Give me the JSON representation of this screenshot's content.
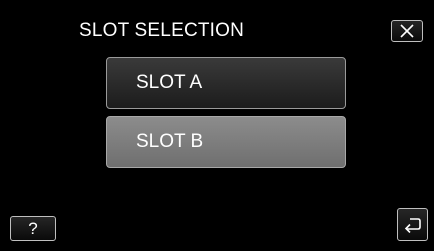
{
  "header": {
    "title": "SLOT SELECTION",
    "close_icon": "close-icon"
  },
  "slots": [
    {
      "label": "SLOT A",
      "state": "normal"
    },
    {
      "label": "SLOT B",
      "state": "highlighted"
    }
  ],
  "footer": {
    "help_label": "?",
    "back_icon": "return-arrow-icon"
  },
  "colors": {
    "background": "#000000",
    "button_border": "#bfbfbf",
    "slot_a_fill": "#2a2a2a",
    "slot_b_fill": "#7d7d7d",
    "text": "#ffffff"
  }
}
